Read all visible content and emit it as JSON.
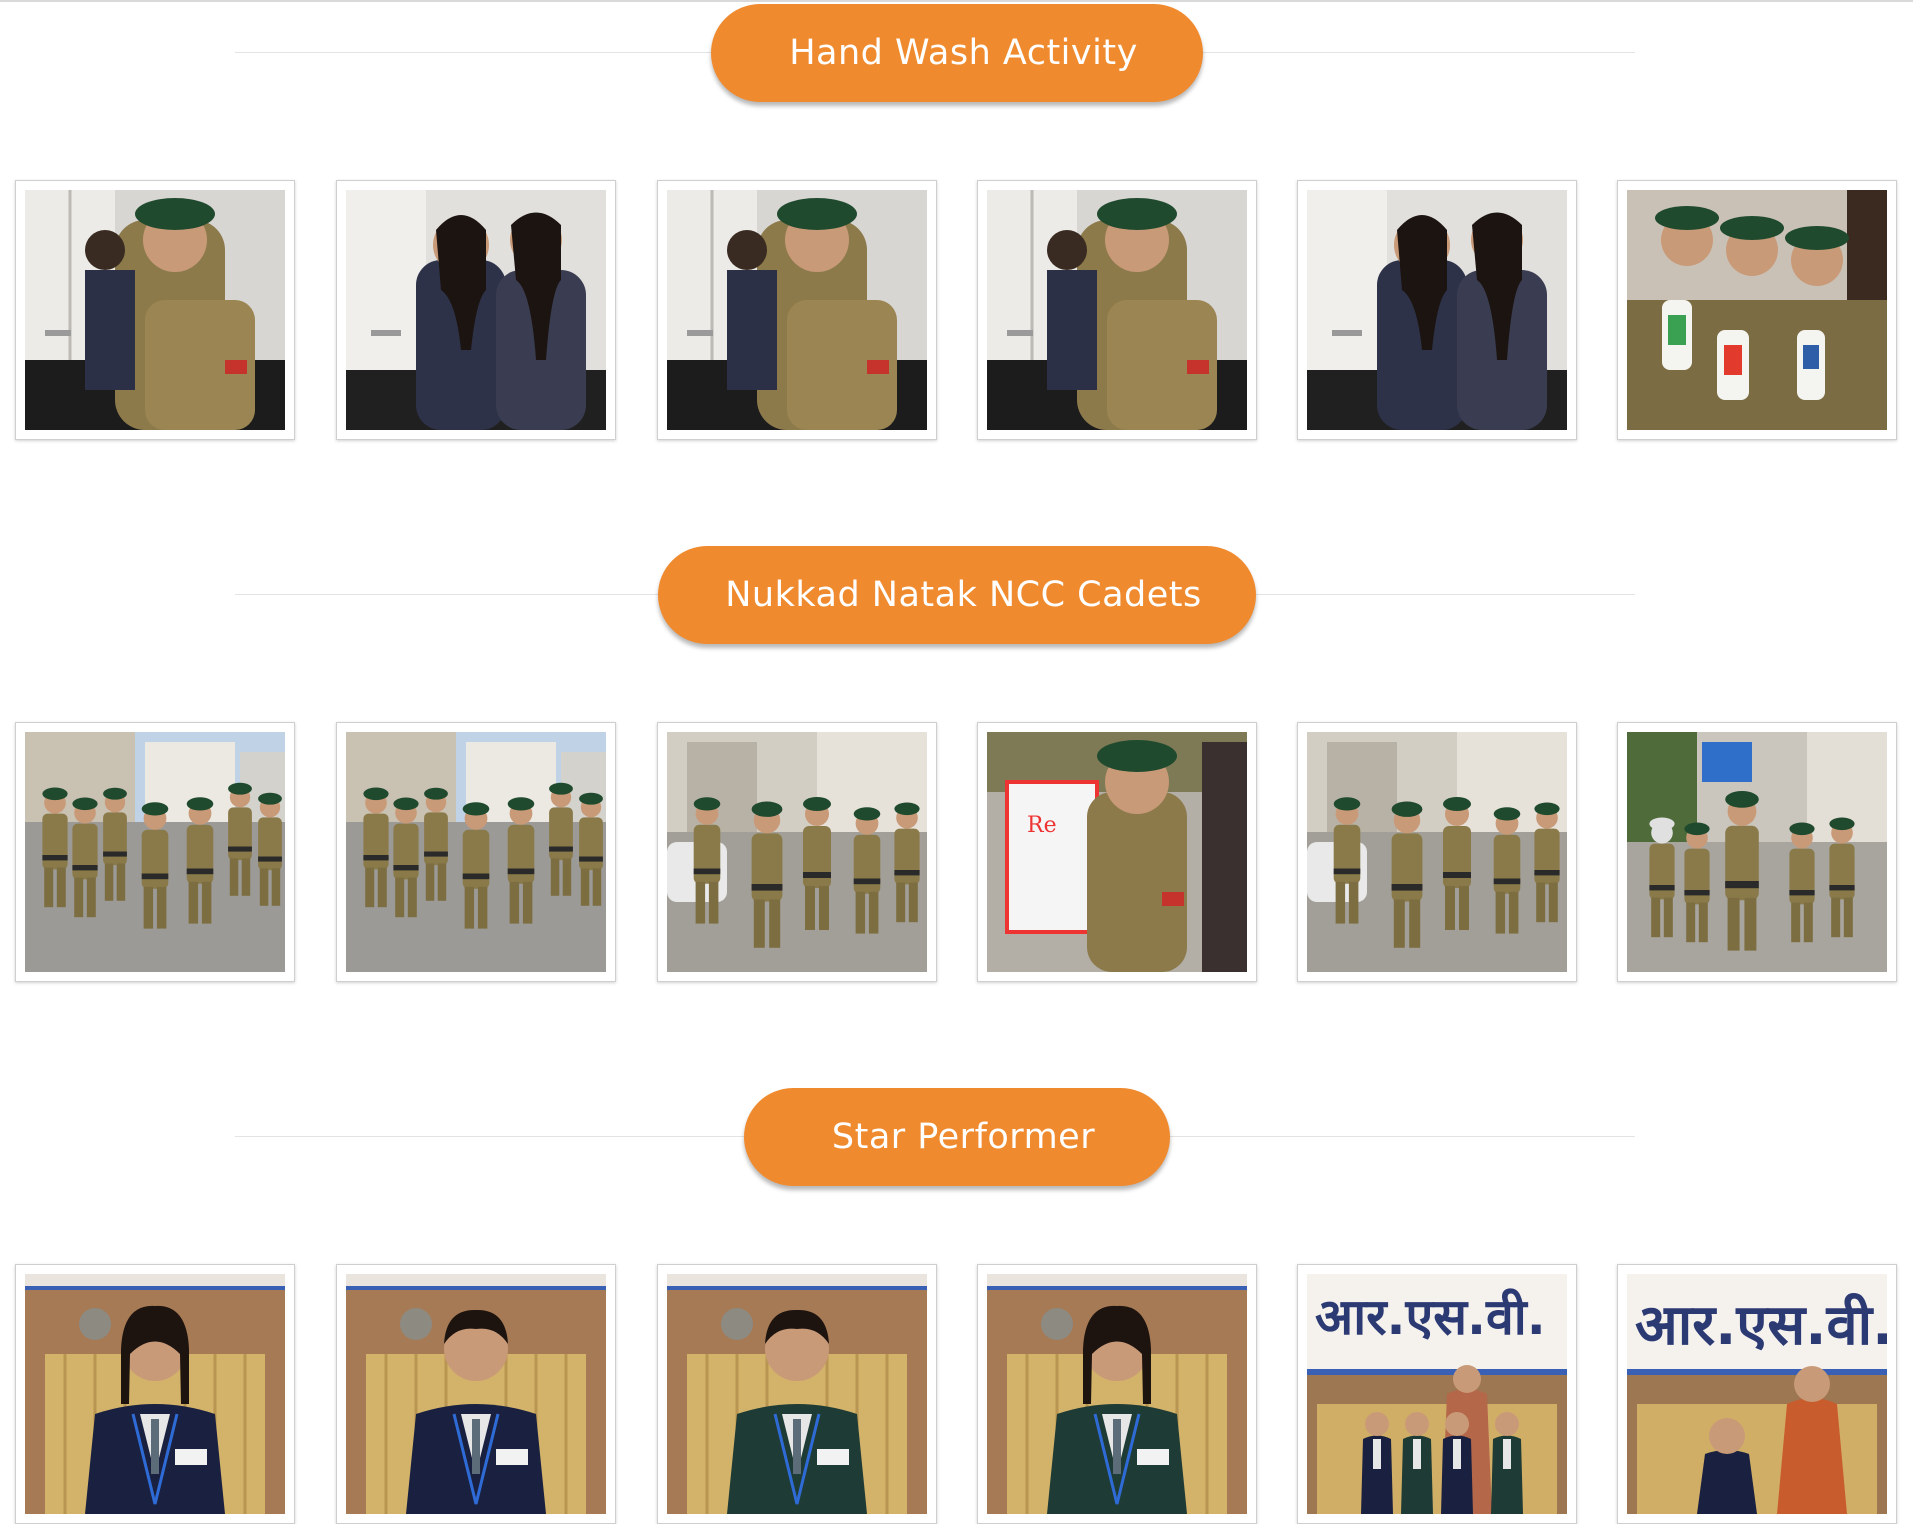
{
  "sections": [
    {
      "title": "Hand Wash Activity",
      "icon": "star-icon",
      "photos": [
        {
          "alt": "Cadets washing hands at sink",
          "scene": "handwash"
        },
        {
          "alt": "Students washing hands",
          "scene": "handwash2"
        },
        {
          "alt": "Cadet using soap",
          "scene": "handwash"
        },
        {
          "alt": "Cadets at sink",
          "scene": "handwash"
        },
        {
          "alt": "Student washing hands",
          "scene": "handwash2"
        },
        {
          "alt": "Cadets holding hand wash bottles",
          "scene": "bottles"
        }
      ]
    },
    {
      "title": "Nukkad Natak NCC Cadets",
      "icon": "star-icon",
      "photos": [
        {
          "alt": "Cadets performing on street",
          "scene": "street"
        },
        {
          "alt": "Cadets street play",
          "scene": "street"
        },
        {
          "alt": "Cadet speaking near car",
          "scene": "street2"
        },
        {
          "alt": "Cadet holding placard",
          "scene": "placard"
        },
        {
          "alt": "Cadets performing",
          "scene": "street2"
        },
        {
          "alt": "Cadet holding blue box",
          "scene": "street3"
        }
      ]
    },
    {
      "title": "Star Performer",
      "icon": "star-icon",
      "photos": [
        {
          "alt": "Star performer girl",
          "scene": "portrait-girl"
        },
        {
          "alt": "Star performer boy",
          "scene": "portrait-boy"
        },
        {
          "alt": "Star performer boy",
          "scene": "portrait-boy2"
        },
        {
          "alt": "Star performer girl",
          "scene": "portrait-girl2"
        },
        {
          "alt": "Group of star performers with teacher",
          "scene": "group",
          "wall_text": "आर.एस.वी."
        },
        {
          "alt": "Star performer with teacher",
          "scene": "group2",
          "wall_text": "आर.एस.वी."
        }
      ]
    }
  ]
}
